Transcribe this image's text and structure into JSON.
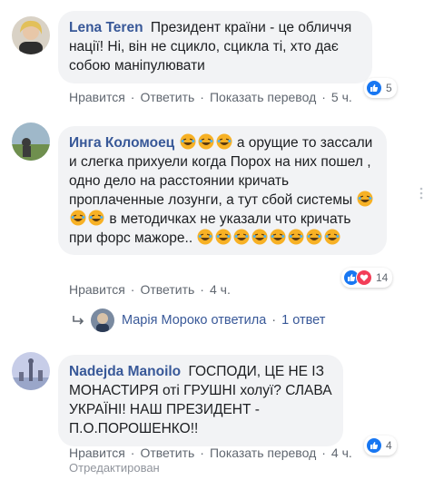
{
  "comments": [
    {
      "author": "Lena Teren",
      "text": "Президент країни - це обличчя нації! Ні, він не сцикло, сцикла ті, хто дає собою маніпулювати",
      "actions": {
        "like": "Нравится",
        "reply": "Ответить",
        "translate": "Показать перевод",
        "time": "5 ч."
      },
      "reactions": {
        "count": "5"
      }
    },
    {
      "author": "Инга Коломоец",
      "text_a": " а орущие то зассали и слегка прихуели когда Порох на них пошел , одно дело на расстоянии кричать проплаченные лозунги, а тут сбой системы",
      "text_b": " в методичках не указали что кричать при форс мажоре.. ",
      "actions": {
        "like": "Нравится",
        "reply": "Ответить",
        "time": "4 ч."
      },
      "reactions": {
        "count": "14"
      }
    },
    {
      "author": "Nadejda Manoilo",
      "text": "ГОСПОДИ, ЦЕ НЕ ІЗ МОНАСТИРЯ оті ГРУШНІ холуї? СЛАВА УКРАЇНІ! НАШ ПРЕЗИДЕНТ - П.О.ПОРОШЕНКО!!",
      "actions": {
        "like": "Нравится",
        "reply": "Ответить",
        "translate": "Показать перевод",
        "time": "4 ч."
      },
      "reactions": {
        "count": "4"
      },
      "edited": "Отредактирован"
    }
  ],
  "reply_summary": {
    "name": "Марія Мороко",
    "verb": "ответила",
    "count": "1 ответ"
  },
  "colors": {
    "link": "#385898",
    "bubble": "#f2f3f5",
    "meta": "#606770",
    "like": "#1877f2",
    "love": "#f33e58",
    "emoji": "#f7b125"
  },
  "icons": [
    "like-icon",
    "love-icon",
    "laughing-emoji-icon",
    "reply-arrow-icon",
    "more-options-icon"
  ]
}
